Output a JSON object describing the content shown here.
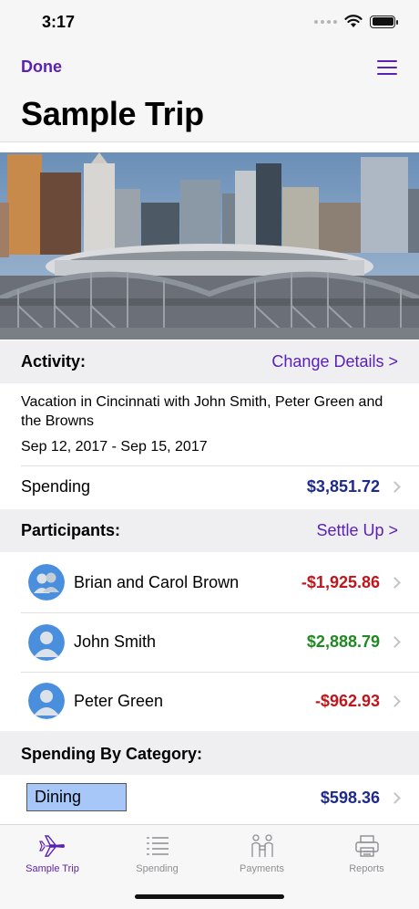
{
  "status_bar": {
    "time": "3:17"
  },
  "nav": {
    "done_label": "Done",
    "title": "Sample Trip"
  },
  "activity": {
    "header": "Activity:",
    "link": "Change Details >",
    "description": "Vacation in Cincinnati with John Smith, Peter Green and the Browns",
    "dates": "Sep 12, 2017 - Sep 15, 2017",
    "spending_label": "Spending",
    "spending_amount": "$3,851.72"
  },
  "participants": {
    "header": "Participants:",
    "link": "Settle Up >",
    "items": [
      {
        "name": "Brian and Carol Brown",
        "amount": "-$1,925.86",
        "color": "#c0161b"
      },
      {
        "name": "John Smith",
        "amount": "$2,888.79",
        "color": "#1f8a23"
      },
      {
        "name": "Peter Green",
        "amount": "-$962.93",
        "color": "#c0161b"
      }
    ]
  },
  "categories": {
    "header": "Spending By Category:",
    "items": [
      {
        "name": "Dining",
        "amount": "$598.36"
      }
    ]
  },
  "tabs": [
    {
      "label": "Sample Trip",
      "icon": "airplane-icon",
      "active": true
    },
    {
      "label": "Spending",
      "icon": "list-icon",
      "active": false
    },
    {
      "label": "Payments",
      "icon": "people-exchange-icon",
      "active": false
    },
    {
      "label": "Reports",
      "icon": "printer-icon",
      "active": false
    }
  ],
  "colors": {
    "accent": "#5b21b6",
    "amount_blue": "#1e2a8c",
    "negative": "#c0161b",
    "positive": "#1f8a23",
    "chip": "#a7c7f9"
  }
}
